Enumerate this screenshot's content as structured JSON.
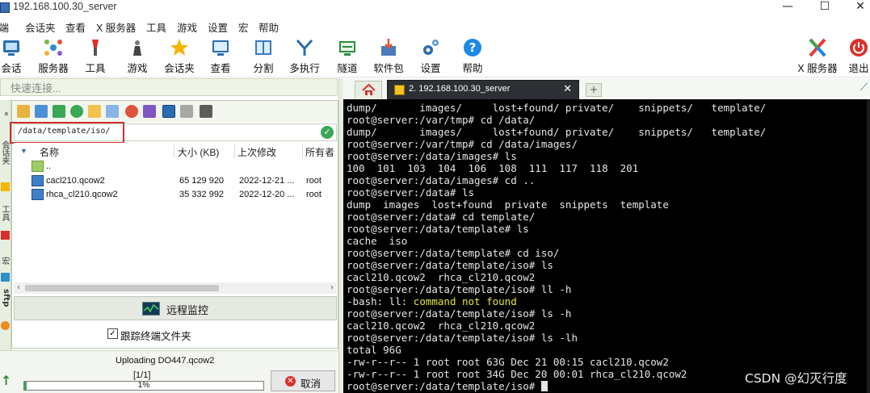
{
  "window": {
    "title": "192.168.100.30_server",
    "controls": [
      "—",
      "☐",
      "✕"
    ]
  },
  "menu": [
    "终端",
    "会话夹",
    "查看",
    "X 服务器",
    "工具",
    "游戏",
    "设置",
    "宏",
    "帮助"
  ],
  "toolbar": {
    "left": [
      {
        "label": "会话",
        "icon": "session-icon",
        "color": "#2b6cb0"
      },
      {
        "label": "服务器",
        "icon": "servers-icon",
        "color": "#2e8fcc"
      },
      {
        "label": "工具",
        "icon": "tools-icon",
        "color": "#d9302c"
      },
      {
        "label": "游戏",
        "icon": "games-icon",
        "color": "#555555"
      },
      {
        "label": "会话夹",
        "icon": "star-icon",
        "color": "#f4b400"
      },
      {
        "label": "查看",
        "icon": "view-icon",
        "color": "#2b6cb0"
      },
      {
        "label": "分割",
        "icon": "split-icon",
        "color": "#3a7ac0"
      },
      {
        "label": "多执行",
        "icon": "multiexec-icon",
        "color": "#2b6cb0"
      },
      {
        "label": "隧道",
        "icon": "tunnel-icon",
        "color": "#2f8a3f"
      },
      {
        "label": "软件包",
        "icon": "packages-icon",
        "color": "#4a7ab8"
      },
      {
        "label": "设置",
        "icon": "settings-icon",
        "color": "#2b6cb0"
      },
      {
        "label": "帮助",
        "icon": "help-icon",
        "color": "#1e88e5"
      }
    ],
    "right": [
      {
        "label": "X 服务器",
        "icon": "x-server-icon",
        "color": "#e53935"
      },
      {
        "label": "退出",
        "icon": "power-icon",
        "color": "#d9302c"
      }
    ]
  },
  "quick_connect": {
    "placeholder": "快速连接..."
  },
  "side_tabs": [
    "会话夹",
    "工具",
    "宏",
    "sftp"
  ],
  "sftp": {
    "path": "/data/template/iso/",
    "columns": [
      "名称",
      "大小 (KB)",
      "上次修改",
      "所有者"
    ],
    "files": [
      {
        "name": "..",
        "size": "",
        "modified": "",
        "owner": "",
        "type": "parent"
      },
      {
        "name": "cacl210.qcow2",
        "size": "65 129 920",
        "modified": "2022-12-21 ...",
        "owner": "root",
        "type": "file"
      },
      {
        "name": "rhca_cl210.qcow2",
        "size": "35 332 992",
        "modified": "2022-12-20 ...",
        "owner": "root",
        "type": "file"
      }
    ],
    "monitor_label": "远程监控",
    "follow_label": "跟踪终端文件夹",
    "follow_checked": true
  },
  "transfer": {
    "status": "Uploading DO447.qcow2",
    "count": "[1/1]",
    "progress_label": "1%",
    "progress": 0.01,
    "cancel_label": "取消"
  },
  "tabs": {
    "active_label": "2. 192.168.100.30_server",
    "close": "✕",
    "new": "+"
  },
  "terminal": {
    "lines": [
      "dump/       images/     lost+found/ private/    snippets/   template/",
      "root@server:/var/tmp# cd /data/",
      "dump/       images/     lost+found/ private/    snippets/   template/",
      "root@server:/var/tmp# cd /data/images/",
      "root@server:/data/images# ls",
      "100  101  103  104  106  108  111  117  118  201",
      "root@server:/data/images# cd ..",
      "root@server:/data# ls",
      "dump  images  lost+found  private  snippets  template",
      "root@server:/data# cd template/",
      "root@server:/data/template# ls",
      "cache  iso",
      "root@server:/data/template# cd iso/",
      "root@server:/data/template/iso# ls",
      "cacl210.qcow2  rhca_cl210.qcow2",
      "root@server:/data/template/iso# ll -h",
      "-bash: ll: ",
      "root@server:/data/template/iso# ls -h",
      "cacl210.qcow2  rhca_cl210.qcow2",
      "root@server:/data/template/iso# ls -lh",
      "total 96G",
      "-rw-r--r-- 1 root root 63G Dec 21 00:15 cacl210.qcow2",
      "-rw-r--r-- 1 root root 34G Dec 20 00:01 rhca_cl210.qcow2",
      "root@server:/data/template/iso# "
    ],
    "error_tail": "command not found"
  },
  "watermark": "CSDN @幻灭行度"
}
